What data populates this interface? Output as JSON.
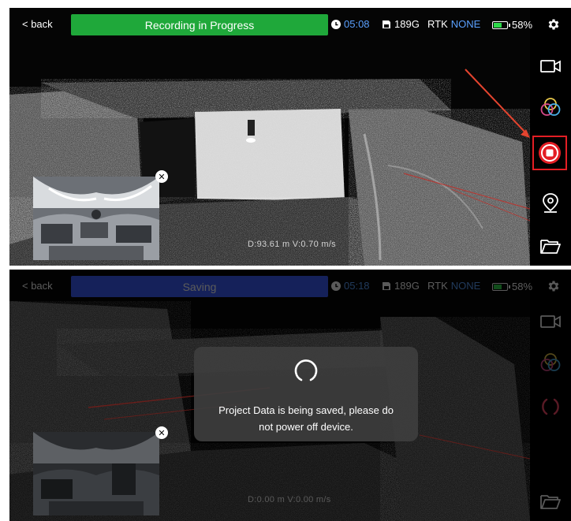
{
  "recording": {
    "back_label": "< back",
    "status": "Recording in Progress",
    "time": "05:08",
    "storage": "189G",
    "rtk_label": "RTK",
    "rtk_value": "NONE",
    "battery": "58%",
    "battery_level": 0.58,
    "readout": "D:93.61 m V:0.70 m/s"
  },
  "saving": {
    "back_label": "< back",
    "status": "Saving",
    "time": "05:18",
    "storage": "189G",
    "rtk_label": "RTK",
    "rtk_value": "NONE",
    "battery": "58%",
    "battery_level": 0.58,
    "readout": "D:0.00 m V:0.00 m/s",
    "dialog_line1": "Project Data is being saved, please do",
    "dialog_line2": "not power off device."
  },
  "colors": {
    "recording_green": "#1fa83a",
    "saving_blue": "#14205a",
    "rtk_blue": "#5aa0ff",
    "stop_red": "#e31e24",
    "battery_green": "#2ed94a"
  },
  "icons": [
    "clock-icon",
    "sd-card-icon",
    "battery-icon",
    "gear-icon",
    "video-camera-icon",
    "color-layers-icon",
    "stop-record-icon",
    "location-pin-icon",
    "folder-icon",
    "close-icon",
    "spinner-icon"
  ]
}
